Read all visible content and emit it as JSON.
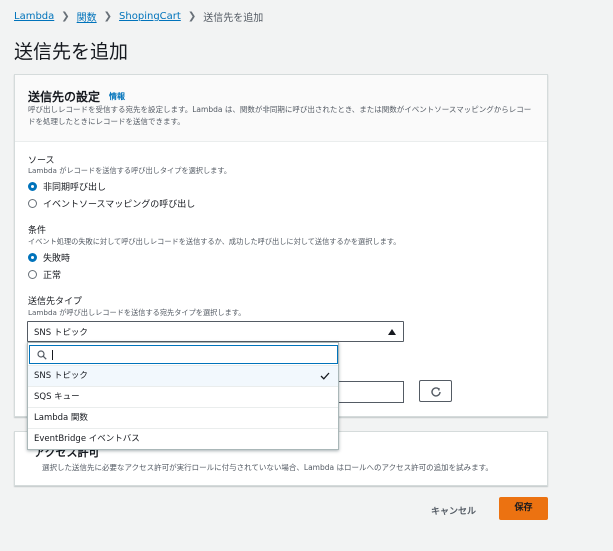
{
  "breadcrumb": {
    "items": [
      "Lambda",
      "関数",
      "ShopingCart"
    ],
    "current": "送信先を追加"
  },
  "page_title": "送信先を追加",
  "config_panel": {
    "title": "送信先の設定",
    "info_link": "情報",
    "description": "呼び出しレコードを受信する宛先を設定します。Lambda は、関数が非同期に呼び出されたとき、または関数がイベントソースマッピングからレコードを処理したときにレコードを送信できます。"
  },
  "source": {
    "label": "ソース",
    "description": "Lambda がレコードを送信する呼び出しタイプを選択します。",
    "options": [
      {
        "label": "非同期呼び出し",
        "selected": true
      },
      {
        "label": "イベントソースマッピングの呼び出し",
        "selected": false
      }
    ]
  },
  "condition": {
    "label": "条件",
    "description": "イベント処理の失敗に対して呼び出しレコードを送信するか、成功した呼び出しに対して送信するかを選択します。",
    "options": [
      {
        "label": "失敗時",
        "selected": true
      },
      {
        "label": "正常",
        "selected": false
      }
    ]
  },
  "destination_type": {
    "label": "送信先タイプ",
    "description": "Lambda が呼び出しレコードを送信する宛先タイプを選択します。",
    "selected": "SNS トピック",
    "search_value": "",
    "options": [
      {
        "label": "SNS トピック",
        "selected": true
      },
      {
        "label": "SQS キュー",
        "selected": false
      },
      {
        "label": "Lambda 関数",
        "selected": false
      },
      {
        "label": "EventBridge イベントバス",
        "selected": false
      }
    ]
  },
  "permissions_panel": {
    "title": "アクセス許可",
    "description": "選択した送信先に必要なアクセス許可が実行ロールに付与されていない場合、Lambda はロールへのアクセス許可の追加を試みます。"
  },
  "footer": {
    "cancel_label": "キャンセル",
    "save_label": "保存"
  },
  "colors": {
    "link": "#0073bb",
    "primary_button": "#ec7211",
    "radio_selected": "#0073bb"
  },
  "icons": [
    "chevron-right-icon",
    "search-icon",
    "check-icon",
    "refresh-icon",
    "caret-up-icon"
  ]
}
